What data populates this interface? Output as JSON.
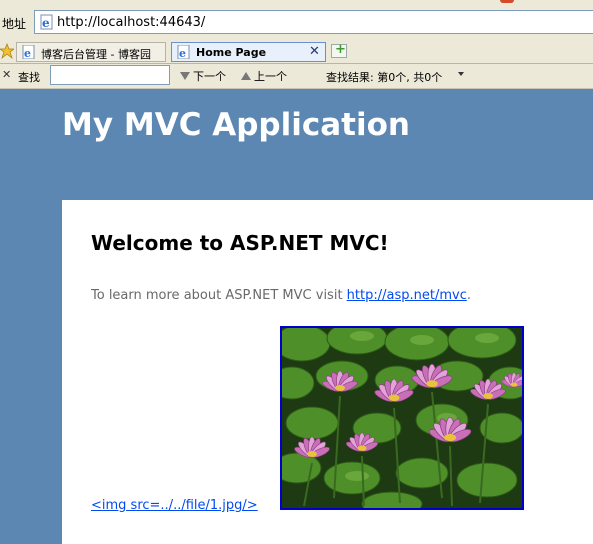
{
  "browser": {
    "address_label": "地址",
    "url": "http://localhost:44643/",
    "tabs": [
      {
        "label": "博客后台管理 - 博客园"
      },
      {
        "label": "Home Page"
      }
    ],
    "find_bar": {
      "label": "查找",
      "input_value": "",
      "next_label": "下一个",
      "prev_label": "上一个",
      "results": "查找结果: 第0个, 共0个"
    }
  },
  "site": {
    "title": "My MVC Application",
    "heading": "Welcome to ASP.NET MVC!",
    "intro_prefix": "To learn more about ASP.NET MVC visit ",
    "intro_link": "http://asp.net/mvc",
    "intro_suffix": ".",
    "image_link_text": "<img src=../../file/1.jpg/>"
  },
  "colors": {
    "header_bg": "#5c87b2",
    "link": "#034af3",
    "image_border": "#0000cc"
  }
}
